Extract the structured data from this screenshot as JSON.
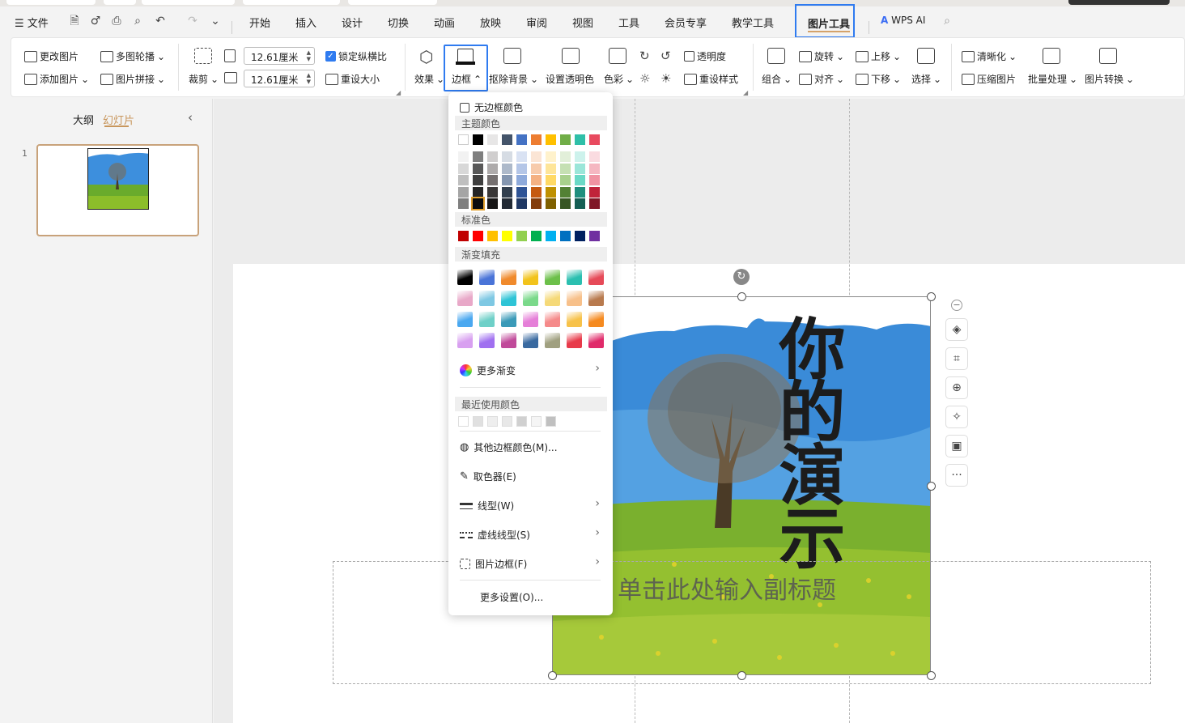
{
  "menubar": {
    "file_label": "文件",
    "tabs": [
      "开始",
      "插入",
      "设计",
      "切换",
      "动画",
      "放映",
      "审阅",
      "视图",
      "工具",
      "会员专享",
      "教学工具"
    ],
    "active_tab": "图片工具",
    "wps_ai": "WPS AI"
  },
  "ribbon": {
    "change_pic": "更改图片",
    "multi_carousel": "多图轮播",
    "add_pic": "添加图片",
    "pic_splice": "图片拼接",
    "crop": "裁剪",
    "width_value": "12.61厘米",
    "height_value": "12.61厘米",
    "lock_ratio": "锁定纵横比",
    "reset_size": "重设大小",
    "effect": "效果",
    "border": "边框",
    "remove_bg": "抠除背景",
    "set_transparent": "设置透明色",
    "color": "色彩",
    "transparency": "透明度",
    "reset_style": "重设样式",
    "group": "组合",
    "rotate": "旋转",
    "align": "对齐",
    "move_up": "上移",
    "move_down": "下移",
    "select": "选择",
    "clarify": "清晰化",
    "compress": "压缩图片",
    "batch": "批量处理",
    "convert": "图片转换"
  },
  "leftpanel": {
    "outline_tab": "大纲",
    "slides_tab": "幻灯片",
    "slide_number": "1"
  },
  "slide": {
    "vertical_title": "你的演示",
    "subtitle_placeholder": "单击此处输入副标题"
  },
  "dropdown": {
    "no_border": "无边框颜色",
    "theme_colors": "主题颜色",
    "standard_colors": "标准色",
    "gradient_fill": "渐变填充",
    "more_gradient": "更多渐变",
    "recent_colors": "最近使用颜色",
    "other_border_color": "其他边框颜色(M)...",
    "eyedropper": "取色器(E)",
    "line_type": "线型(W)",
    "dash_type": "虚线线型(S)",
    "pic_border": "图片边框(F)",
    "more_settings": "更多设置(O)...",
    "theme_top": [
      "#ffffff",
      "#000000",
      "#e7e6e6",
      "#44546a",
      "#4472c4",
      "#ed7d31",
      "#ffc000",
      "#70ad47",
      "#2fbfa8",
      "#e84a5f"
    ],
    "theme_shades": [
      [
        "#f2f2f2",
        "#7f7f7f",
        "#d0cece",
        "#d6dce4",
        "#d9e2f3",
        "#fbe5d5",
        "#fff2cc",
        "#e2efd9",
        "#cdf2ec",
        "#fadbe0"
      ],
      [
        "#d8d8d8",
        "#595959",
        "#aeabab",
        "#adb9ca",
        "#b4c6e7",
        "#f7cbac",
        "#fee599",
        "#c5e0b3",
        "#9be6d9",
        "#f5b7c1"
      ],
      [
        "#bfbfbf",
        "#3f3f3f",
        "#757070",
        "#8496b0",
        "#8eaadb",
        "#f4b183",
        "#ffd965",
        "#a8d08d",
        "#6ad9c6",
        "#f093a2"
      ],
      [
        "#a5a5a5",
        "#262626",
        "#3a3838",
        "#323f4f",
        "#2f5496",
        "#c55a11",
        "#bf9000",
        "#538135",
        "#1f8f7e",
        "#c0233a"
      ],
      [
        "#7f7f7f",
        "#0c0c0c",
        "#171616",
        "#222a35",
        "#1f3864",
        "#833c0b",
        "#7f6000",
        "#375623",
        "#155f54",
        "#801727"
      ]
    ],
    "standard": [
      "#c00000",
      "#ff0000",
      "#ffc000",
      "#ffff00",
      "#92d050",
      "#00b050",
      "#00b0f0",
      "#0070c0",
      "#002060",
      "#7030a0"
    ],
    "gradients": [
      [
        "#000000",
        "#4a74d8",
        "#f08a2c",
        "#f2c31c",
        "#6cc04a",
        "#2bbfb0",
        "#e64a58"
      ],
      [
        "#e8a8c8",
        "#7ec8e3",
        "#2ec4d6",
        "#7ad98a",
        "#f5d978",
        "#f7c08a",
        "#b87a4e"
      ],
      [
        "#4aa8f0",
        "#6ed0c8",
        "#3a9ab8",
        "#e57fd8",
        "#f58a8a",
        "#f7c24a",
        "#f58a20"
      ],
      [
        "#d8a0f0",
        "#a070f0",
        "#c04a9a",
        "#3a6aa0",
        "#a0a080",
        "#e83a4a",
        "#e02a6a"
      ]
    ],
    "recent": [
      "#ffffff",
      "#e0e0e0",
      "#eeeeee",
      "#e8e8e8",
      "#d0d0d0",
      "#f5f5f5",
      "#c0c0c0"
    ]
  }
}
